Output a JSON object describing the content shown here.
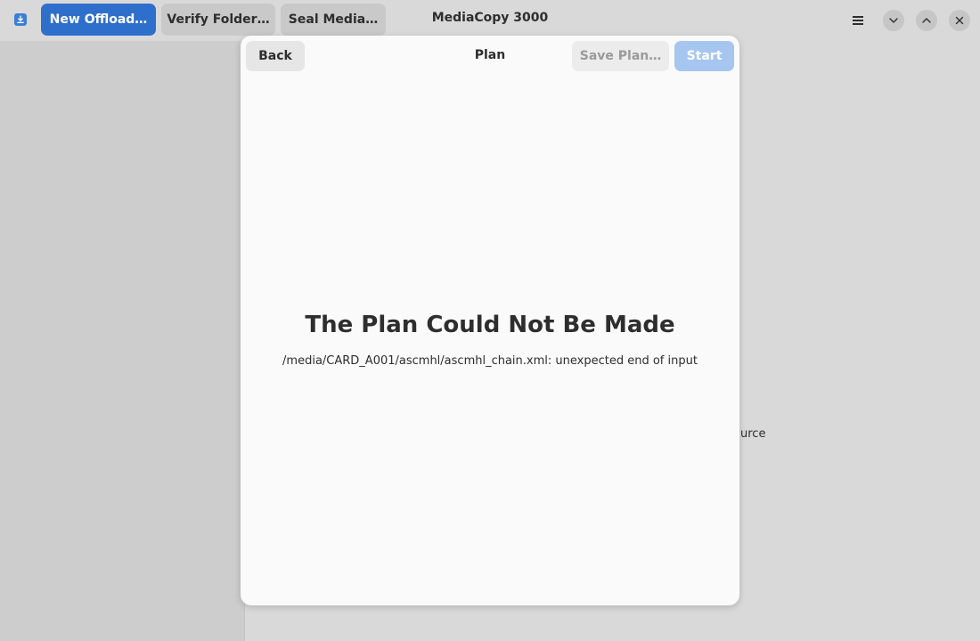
{
  "header": {
    "app_icon": "download-icon",
    "new_offload_label": "New Offload…",
    "verify_folder_label": "Verify Folder…",
    "seal_media_label": "Seal Media…",
    "title": "MediaCopy 3000",
    "menu_icon": "hamburger-menu-icon",
    "minimize_icon": "chevron-down-icon",
    "maximize_icon": "chevron-up-icon",
    "close_icon": "close-icon"
  },
  "background": {
    "partial_text": "urce"
  },
  "dialog": {
    "back_label": "Back",
    "title": "Plan",
    "save_plan_label": "Save Plan…",
    "start_label": "Start",
    "status_title": "The Plan Could Not Be Made",
    "status_description": "/media/CARD_A001/ascmhl/ascmhl_chain.xml: unexpected end of input"
  },
  "colors": {
    "accent": "#2f6fcc",
    "accent_disabled": "#a6c6f0",
    "dialog_bg": "#fafafa",
    "window_bg": "#d9d9da"
  }
}
